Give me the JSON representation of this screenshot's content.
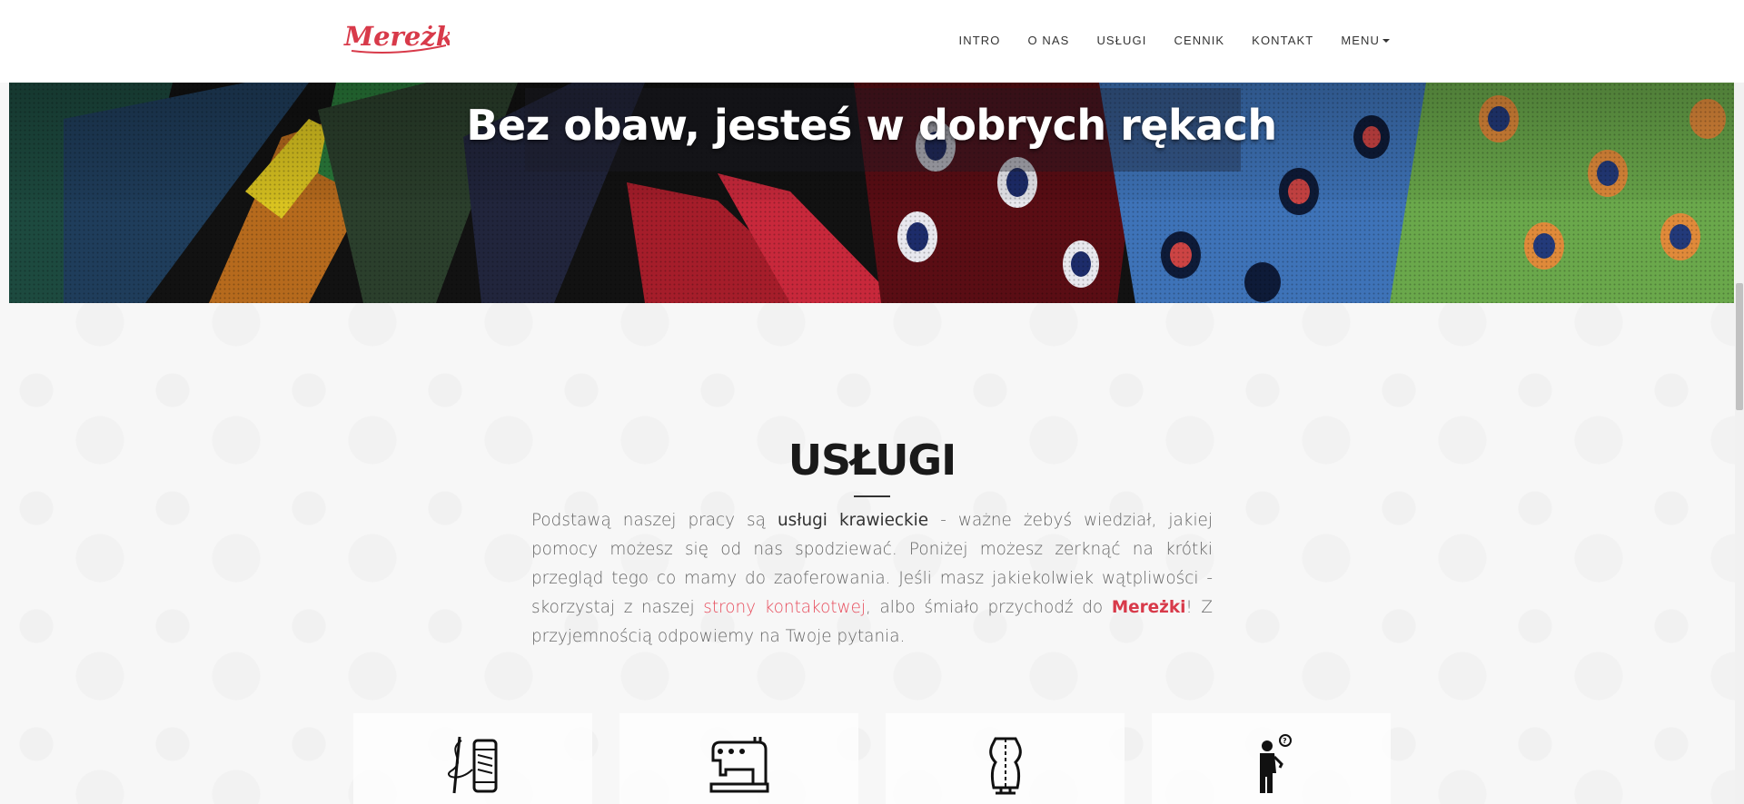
{
  "nav": {
    "logo_text": "Mereżka",
    "items": [
      {
        "label": "INTRO"
      },
      {
        "label": "O NAS"
      },
      {
        "label": "USŁUGI"
      },
      {
        "label": "CENNIK"
      },
      {
        "label": "KONTAKT"
      },
      {
        "label": "MENU"
      }
    ]
  },
  "hero": {
    "title": "Bez obaw, jesteś w dobrych rękach"
  },
  "services": {
    "title": "USŁUGI",
    "text": {
      "p1": "Podstawą naszej pracy są ",
      "bold": "usługi krawieckie",
      "p2": " - ważne żebyś wiedział, jakiej pomocy możesz się od nas spodziewać. Poniżej możesz zerknąć na krótki przegląd tego co mamy do zaoferowania. Jeśli masz jakiekolwiek wątpliwości - skorzystaj z naszej ",
      "link": "strony kontakotwej",
      "p3": ", albo śmiało przychodź do ",
      "brand": "Mereżki",
      "p4": "! Z przyjemnością odpowiemy na Twoje pytania."
    },
    "cards": [
      {
        "icon": "needle-thread-icon"
      },
      {
        "icon": "sewing-machine-icon"
      },
      {
        "icon": "tailor-mannequin-icon"
      },
      {
        "icon": "question-person-icon"
      }
    ]
  },
  "colors": {
    "brand": "#d83a4a",
    "link": "#e74c5c",
    "heading": "#1a1a1a",
    "text": "#666666"
  }
}
